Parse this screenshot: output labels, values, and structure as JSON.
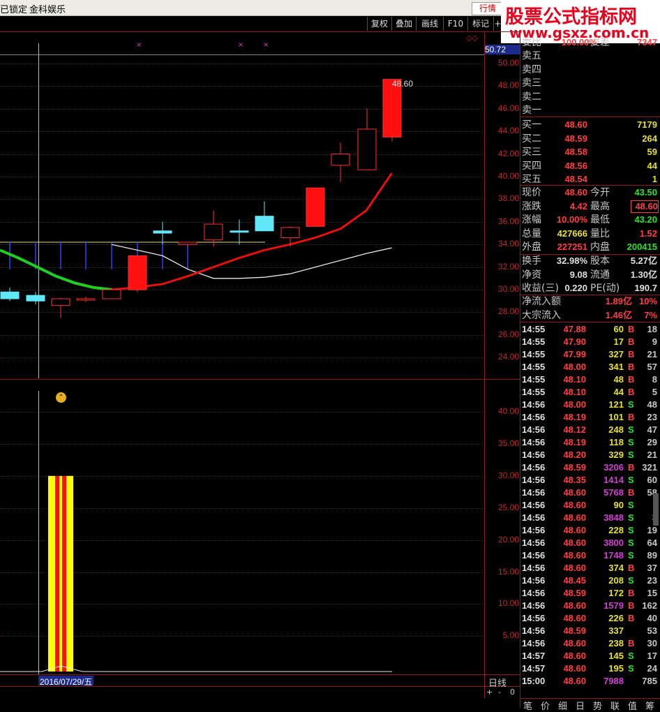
{
  "menu": {
    "locked": "已锁定",
    "app_name": "金科娱乐",
    "hq_tab": "行情"
  },
  "watermark": {
    "line1": "股票公式指标网",
    "line2": "www.gsxz.com.cn"
  },
  "toolbar": {
    "items": [
      "复权",
      "叠加",
      "画线",
      "F10",
      "标记",
      "+"
    ]
  },
  "chart": {
    "top_value": "50.72",
    "price_ticks": [
      "50.00",
      "48.00",
      "46.00",
      "44.00",
      "42.00",
      "40.00",
      "38.00",
      "36.00",
      "34.00",
      "32.00",
      "30.00",
      "28.00",
      "26.00",
      "24.00"
    ],
    "high_label": "48.60",
    "date_label": "2016/07/29/五",
    "period_label": "日线",
    "zoom_controls": [
      "+",
      "-",
      "0"
    ],
    "vol_ticks": [
      "40.00",
      "35.00",
      "30.00",
      "25.00",
      "20.00",
      "15.00",
      "10.00",
      "5.00"
    ],
    "sell_header_left": "委比",
    "sell_header_pct": "100.00%",
    "sell_header_right": "委差",
    "sell_header_val": "7347"
  },
  "chart_data": {
    "type": "candlestick",
    "ylim": [
      22.5,
      51.5
    ],
    "candles": [
      {
        "o": 29.8,
        "h": 30.2,
        "l": 29.0,
        "c": 29.2,
        "color": "cyan"
      },
      {
        "o": 29.5,
        "h": 29.8,
        "l": 28.7,
        "c": 29.0,
        "color": "cyan"
      },
      {
        "o": 28.6,
        "h": 29.3,
        "l": 27.5,
        "c": 29.2,
        "color": "red_hollow"
      },
      {
        "o": 29.1,
        "h": 29.4,
        "l": 28.9,
        "c": 29.2,
        "color": "red_hollow"
      },
      {
        "o": 29.2,
        "h": 30.2,
        "l": 29.2,
        "c": 30.0,
        "color": "red_hollow"
      },
      {
        "o": 30.0,
        "h": 33.0,
        "l": 29.8,
        "c": 33.0,
        "color": "red"
      },
      {
        "o": 35.0,
        "h": 36.0,
        "l": 34.0,
        "c": 35.2,
        "color": "cyan"
      },
      {
        "o": 34.0,
        "h": 34.2,
        "l": 33.8,
        "c": 34.2,
        "color": "red_hollow"
      },
      {
        "o": 34.4,
        "h": 37.0,
        "l": 33.8,
        "c": 35.8,
        "color": "red_hollow"
      },
      {
        "o": 35.2,
        "h": 36.2,
        "l": 34.0,
        "c": 35.2,
        "color": "cyan"
      },
      {
        "o": 36.5,
        "h": 37.8,
        "l": 35.2,
        "c": 35.2,
        "color": "cyan"
      },
      {
        "o": 34.6,
        "h": 35.6,
        "l": 33.8,
        "c": 35.5,
        "color": "red_hollow"
      },
      {
        "o": 35.6,
        "h": 39.0,
        "l": 35.6,
        "c": 39.0,
        "color": "red"
      },
      {
        "o": 41.0,
        "h": 43.0,
        "l": 39.5,
        "c": 42.0,
        "color": "red_hollow"
      },
      {
        "o": 40.6,
        "h": 46.0,
        "l": 40.6,
        "c": 44.2,
        "color": "red_hollow"
      },
      {
        "o": 43.5,
        "h": 48.6,
        "l": 43.1,
        "c": 48.6,
        "color": "red"
      }
    ],
    "ma_red": [
      30.0,
      30.2,
      30.5,
      31.2,
      32.0,
      32.8,
      33.5,
      34.0,
      34.6,
      35.4,
      37.0,
      40.3
    ],
    "ma_green": [
      33.5,
      32.8,
      32.0,
      31.2,
      30.6,
      30.2,
      30.0
    ],
    "ma_white": [
      34.0,
      33.5,
      33.0,
      31.8,
      31.0,
      31.0,
      31.1,
      31.4,
      32.0,
      32.6,
      33.2,
      33.7
    ],
    "volume_bar": {
      "value": 30.0,
      "ylim": [
        0,
        45
      ]
    }
  },
  "quotes": {
    "sell": [
      {
        "label": "卖五"
      },
      {
        "label": "卖四"
      },
      {
        "label": "卖三"
      },
      {
        "label": "卖二"
      },
      {
        "label": "卖一"
      }
    ],
    "buy": [
      {
        "label": "买一",
        "price": "48.60",
        "vol": "7179"
      },
      {
        "label": "买二",
        "price": "48.59",
        "vol": "264"
      },
      {
        "label": "买三",
        "price": "48.58",
        "vol": "59"
      },
      {
        "label": "买四",
        "price": "48.56",
        "vol": "44"
      },
      {
        "label": "买五",
        "price": "48.54",
        "vol": "1"
      }
    ],
    "stats": [
      {
        "l1": "现价",
        "v1": "48.60",
        "c1": "#ff4040",
        "l2": "今开",
        "v2": "43.50",
        "c2": "#30e030"
      },
      {
        "l1": "涨跌",
        "v1": "4.42",
        "c1": "#ff4040",
        "l2": "最高",
        "v2": "48.60",
        "c2": "#ff4040",
        "box": true
      },
      {
        "l1": "涨幅",
        "v1": "10.00%",
        "c1": "#ff4040",
        "l2": "最低",
        "v2": "43.20",
        "c2": "#30e030"
      },
      {
        "l1": "总量",
        "v1": "427666",
        "c1": "#e8e030",
        "l2": "量比",
        "v2": "1.52",
        "c2": "#ff4040"
      },
      {
        "l1": "外盘",
        "v1": "227251",
        "c1": "#ff4040",
        "l2": "内盘",
        "v2": "200415",
        "c2": "#30e030"
      }
    ],
    "stats2": [
      {
        "l1": "换手",
        "v1": "32.98%",
        "c1": "#e0e0e0",
        "l2": "股本",
        "v2": "5.27亿",
        "c2": "#e0e0e0"
      },
      {
        "l1": "净资",
        "v1": "9.08",
        "c1": "#e0e0e0",
        "l2": "流通",
        "v2": "1.30亿",
        "c2": "#e0e0e0"
      },
      {
        "l1": "收益(三)",
        "v1": "0.220",
        "c1": "#e0e0e0",
        "l2": "PE(动)",
        "v2": "190.7",
        "c2": "#e0e0e0"
      }
    ],
    "flows": [
      {
        "label": "净流入额",
        "val": "1.89亿",
        "pct": "10%"
      },
      {
        "label": "大宗流入",
        "val": "1.46亿",
        "pct": "7%"
      }
    ]
  },
  "ticks": [
    {
      "t": "14:55",
      "p": "47.88",
      "v": "60",
      "bs": "B",
      "n": "18",
      "vc": "#e8e030"
    },
    {
      "t": "14:55",
      "p": "47.90",
      "v": "17",
      "bs": "B",
      "n": "9",
      "vc": "#e8e030"
    },
    {
      "t": "14:55",
      "p": "47.99",
      "v": "327",
      "bs": "B",
      "n": "21",
      "vc": "#e8e030"
    },
    {
      "t": "14:55",
      "p": "48.00",
      "v": "341",
      "bs": "B",
      "n": "57",
      "vc": "#e8e030"
    },
    {
      "t": "14:55",
      "p": "48.10",
      "v": "48",
      "bs": "B",
      "n": "8",
      "vc": "#e8e030"
    },
    {
      "t": "14:55",
      "p": "48.10",
      "v": "44",
      "bs": "B",
      "n": "5",
      "vc": "#e8e030"
    },
    {
      "t": "14:56",
      "p": "48.00",
      "v": "121",
      "bs": "S",
      "n": "48",
      "vc": "#e8e030"
    },
    {
      "t": "14:56",
      "p": "48.19",
      "v": "101",
      "bs": "B",
      "n": "23",
      "vc": "#e8e030"
    },
    {
      "t": "14:56",
      "p": "48.12",
      "v": "248",
      "bs": "S",
      "n": "47",
      "vc": "#e8e030"
    },
    {
      "t": "14:56",
      "p": "48.19",
      "v": "118",
      "bs": "S",
      "n": "29",
      "vc": "#e8e030"
    },
    {
      "t": "14:56",
      "p": "48.20",
      "v": "329",
      "bs": "S",
      "n": "21",
      "vc": "#e8e030"
    },
    {
      "t": "14:56",
      "p": "48.59",
      "v": "3206",
      "bs": "B",
      "n": "321",
      "vc": "#d040d0"
    },
    {
      "t": "14:56",
      "p": "48.35",
      "v": "1414",
      "bs": "S",
      "n": "60",
      "vc": "#d040d0"
    },
    {
      "t": "14:56",
      "p": "48.60",
      "v": "5768",
      "bs": "B",
      "n": "58",
      "vc": "#d040d0"
    },
    {
      "t": "14:56",
      "p": "48.60",
      "v": "90",
      "bs": "S",
      "n": "",
      "vc": "#e8e030"
    },
    {
      "t": "14:56",
      "p": "48.60",
      "v": "3848",
      "bs": "S",
      "n": "3",
      "vc": "#d040d0"
    },
    {
      "t": "14:56",
      "p": "48.60",
      "v": "228",
      "bs": "S",
      "n": "19",
      "vc": "#e8e030"
    },
    {
      "t": "14:56",
      "p": "48.60",
      "v": "3800",
      "bs": "S",
      "n": "64",
      "vc": "#d040d0"
    },
    {
      "t": "14:56",
      "p": "48.60",
      "v": "1748",
      "bs": "S",
      "n": "89",
      "vc": "#d040d0"
    },
    {
      "t": "14:56",
      "p": "48.60",
      "v": "374",
      "bs": "B",
      "n": "37",
      "vc": "#e8e030"
    },
    {
      "t": "14:56",
      "p": "48.45",
      "v": "208",
      "bs": "S",
      "n": "23",
      "vc": "#e8e030"
    },
    {
      "t": "14:56",
      "p": "48.59",
      "v": "172",
      "bs": "B",
      "n": "15",
      "vc": "#e8e030"
    },
    {
      "t": "14:56",
      "p": "48.60",
      "v": "1579",
      "bs": "B",
      "n": "162",
      "vc": "#d040d0"
    },
    {
      "t": "14:56",
      "p": "48.60",
      "v": "226",
      "bs": "B",
      "n": "40",
      "vc": "#e8e030"
    },
    {
      "t": "14:56",
      "p": "48.59",
      "v": "337",
      "bs": "",
      "n": "53",
      "vc": "#e8e030"
    },
    {
      "t": "14:56",
      "p": "48.60",
      "v": "238",
      "bs": "B",
      "n": "30",
      "vc": "#e8e030"
    },
    {
      "t": "14:57",
      "p": "48.60",
      "v": "145",
      "bs": "S",
      "n": "17",
      "vc": "#e8e030"
    },
    {
      "t": "14:57",
      "p": "48.60",
      "v": "195",
      "bs": "S",
      "n": "24",
      "vc": "#e8e030"
    },
    {
      "t": "15:00",
      "p": "48.60",
      "v": "7988",
      "bs": "",
      "n": "785",
      "vc": "#d040d0"
    }
  ],
  "bottom_tabs": [
    "笔",
    "价",
    "细",
    "日",
    "势",
    "联",
    "值",
    "筹"
  ]
}
